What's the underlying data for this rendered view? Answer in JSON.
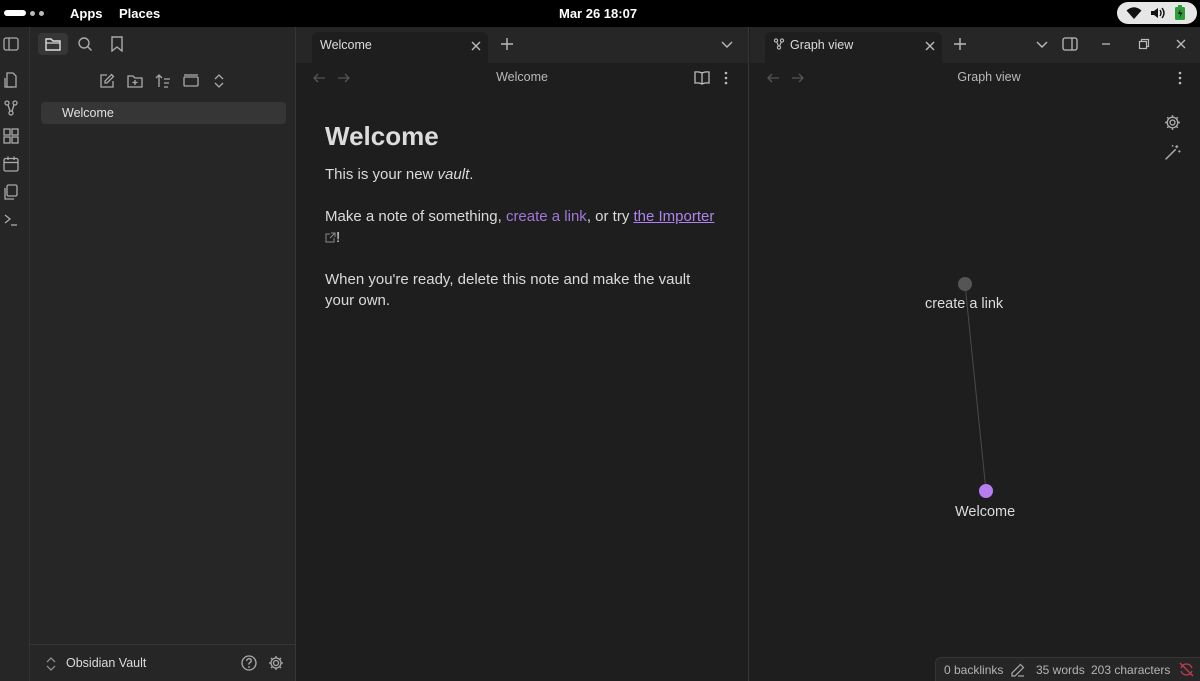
{
  "system_bar": {
    "apps": "Apps",
    "places": "Places",
    "clock": "Mar 26  18:07"
  },
  "sidebar": {
    "file_items": [
      {
        "label": "Welcome"
      }
    ],
    "vault_name": "Obsidian Vault"
  },
  "left_pane": {
    "tab_label": "Welcome",
    "view_title": "Welcome",
    "note": {
      "heading": "Welcome",
      "p1_prefix": "This is your new ",
      "p1_em": "vault",
      "p1_suffix": ".",
      "p2_prefix": "Make a note of something, ",
      "p2_internal_link": "create a link",
      "p2_middle": ", or try ",
      "p2_external_link": "the Importer",
      "p2_suffix": "!",
      "p3": "When you're ready, delete this note and make the vault your own."
    }
  },
  "right_pane": {
    "tab_label": "Graph view",
    "view_title": "Graph view",
    "graph": {
      "nodes": [
        {
          "label": "create a link",
          "color": "#555555"
        },
        {
          "label": "Welcome",
          "color": "#b77ef0"
        }
      ]
    }
  },
  "status_bar": {
    "backlinks": "0 backlinks",
    "words": "35 words",
    "characters": "203 characters"
  },
  "colors": {
    "accent": "#a277d8",
    "background": "#1e1e1e",
    "sidebar": "#262626"
  }
}
